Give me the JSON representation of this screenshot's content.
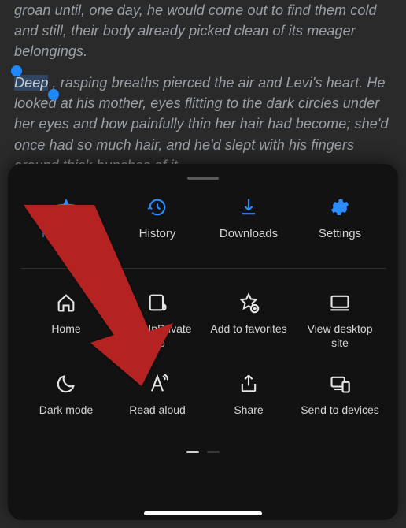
{
  "reader": {
    "para1": "groan until, one day, he would come out to find them cold and still, their body already picked clean of its meager belongings.",
    "para2_sel": "Deep",
    "para2_rest": ", rasping breaths pierced the air and Levi's heart. He looked at his mother, eyes flitting to the dark circles under her eyes and how painfully thin her hair had become; she'd once had so much hair, and he'd slept with his fingers around thick bunches of it."
  },
  "menu": {
    "top": {
      "favorites": "Favorites",
      "history": "History",
      "downloads": "Downloads",
      "settings": "Settings"
    },
    "mid": {
      "home": "Home",
      "newinprivate": "New InPrivate tab",
      "addfav": "Add to favorites",
      "desktop": "View desktop site"
    },
    "low": {
      "darkmode": "Dark mode",
      "readaloud": "Read aloud",
      "share": "Share",
      "sendto": "Send to devices"
    }
  },
  "colors": {
    "accent": "#2b8cff",
    "arrow": "#b52121"
  }
}
